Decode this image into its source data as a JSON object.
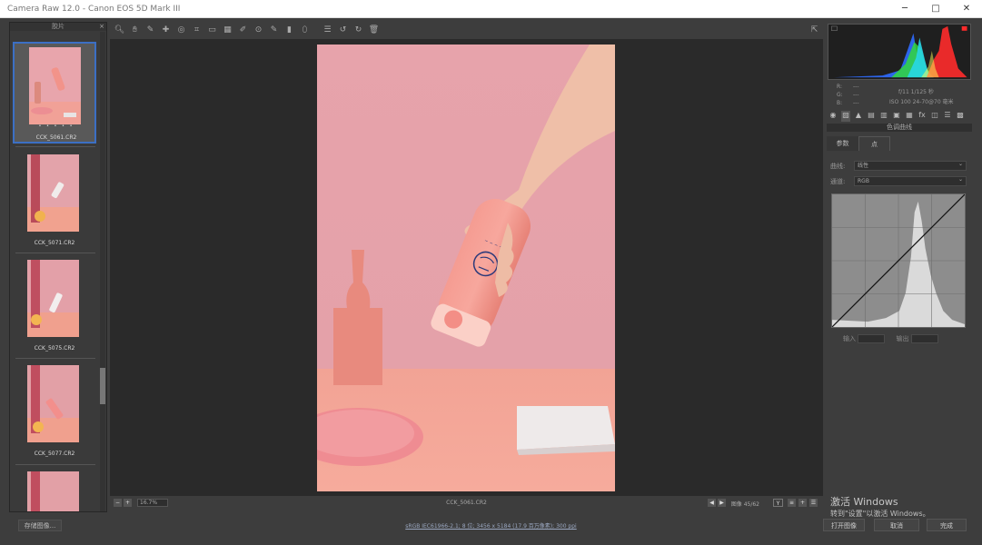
{
  "window": {
    "title": "Camera Raw 12.0  -  Canon EOS 5D Mark III",
    "controls": [
      "─",
      "□",
      "✕"
    ]
  },
  "filmstrip": {
    "header": "胶片",
    "close_icon": "×",
    "items": [
      {
        "name": "CCK_5061.CR2",
        "stars": "• • • • •",
        "selected": true
      },
      {
        "name": "CCK_5071.CR2",
        "selected": false
      },
      {
        "name": "CCK_5075.CR2",
        "selected": false
      },
      {
        "name": "CCK_5077.CR2",
        "selected": false
      },
      {
        "name": "",
        "selected": false
      }
    ]
  },
  "toolbar": {
    "tools": [
      {
        "name": "zoom-tool",
        "glyph": "🔍︎"
      },
      {
        "name": "hand-tool",
        "glyph": "✋︎"
      },
      {
        "name": "white-balance-tool",
        "glyph": "✎"
      },
      {
        "name": "color-sampler-tool",
        "glyph": "✚"
      },
      {
        "name": "targeted-adjust-tool",
        "glyph": "◎"
      },
      {
        "name": "crop-tool",
        "glyph": "⌗"
      },
      {
        "name": "straighten-tool",
        "glyph": "▭"
      },
      {
        "name": "transform-tool",
        "glyph": "▦"
      },
      {
        "name": "spot-removal-tool",
        "glyph": "✐"
      },
      {
        "name": "red-eye-tool",
        "glyph": "⊙"
      },
      {
        "name": "adjustment-brush-tool",
        "glyph": "✎"
      },
      {
        "name": "graduated-filter-tool",
        "glyph": "▮"
      },
      {
        "name": "radial-filter-tool",
        "glyph": "⬯"
      },
      {
        "name": "preferences-tool",
        "glyph": "☰"
      },
      {
        "name": "rotate-left-tool",
        "glyph": "↺"
      },
      {
        "name": "rotate-right-tool",
        "glyph": "↻"
      },
      {
        "name": "delete-tool",
        "glyph": "🗑︎"
      }
    ],
    "fullscreen_glyph": "⇱"
  },
  "canvas": {
    "zoom": "16.7%",
    "filename": "CCK_5061.CR2",
    "image_count": "图像 45/62"
  },
  "histogram": {
    "colors": {
      "red": "#ff2b2b",
      "green": "#32e032",
      "blue": "#2f6bff",
      "cyan": "#28d7e8"
    }
  },
  "metadata": {
    "rgb_labels": [
      "R:",
      "G:",
      "B:"
    ],
    "rgb_values": [
      "---",
      "---",
      "---"
    ],
    "exposure": "f/11  1/125 秒",
    "iso": "ISO 100  24-70@70 毫米"
  },
  "panel": {
    "title": "色调曲线",
    "tabs": [
      "参数",
      "点"
    ],
    "curve_label": "曲线:",
    "curve_value": "线性",
    "channel_label": "通道:",
    "channel_value": "RGB",
    "input_label": "输入",
    "output_label": "输出"
  },
  "bottom": {
    "save_button": "存储图像...",
    "workflow": "sRGB IEC61966-2.1; 8 位; 3456 x 5184 (17.9 百万像素); 300 ppi",
    "open_button": "打开图像",
    "cancel_button": "取消",
    "done_button": "完成"
  },
  "watermark": {
    "line1": "激活 Windows",
    "line2": "转到\"设置\"以激活 Windows。"
  }
}
